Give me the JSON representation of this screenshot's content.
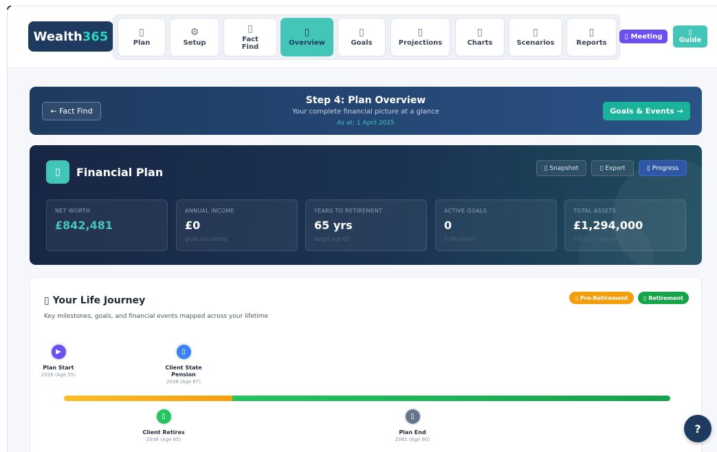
{
  "brand": {
    "name": "Wealth",
    "accent": "365"
  },
  "nav": [
    {
      "label": "Plan",
      "icon": "map-icon",
      "glyph": "▯"
    },
    {
      "label": "Setup",
      "icon": "gear-icon",
      "glyph": "⚙"
    },
    {
      "label": "Fact Find",
      "icon": "clipboard-icon",
      "glyph": "▯"
    },
    {
      "label": "Overview",
      "icon": "chart-icon",
      "glyph": "▯"
    },
    {
      "label": "Goals",
      "icon": "target-icon",
      "glyph": "▯"
    },
    {
      "label": "Projections",
      "icon": "trend-icon",
      "glyph": "▯"
    },
    {
      "label": "Charts",
      "icon": "bar-chart-icon",
      "glyph": "▯"
    },
    {
      "label": "Scenarios",
      "icon": "branch-icon",
      "glyph": "▯"
    },
    {
      "label": "Reports",
      "icon": "document-icon",
      "glyph": "▯"
    }
  ],
  "meeting_label": "▯ Meeting",
  "guide": {
    "glyph": "▯",
    "label": "Guide"
  },
  "step": {
    "back_label": "← Fact Find",
    "title": "Step 4: Plan Overview",
    "subtitle": "Your complete financial picture at a glance",
    "as_at": "As at: 1 April 2025",
    "next_label": "Goals & Events →"
  },
  "plan": {
    "icon_glyph": "▯",
    "title": "Financial Plan",
    "actions": {
      "snapshot": "▯ Snapshot",
      "export": "▯ Export",
      "progress": "▯ Progress"
    },
    "stats": [
      {
        "label": "NET WORTH",
        "value": "£842,481",
        "sub": ""
      },
      {
        "label": "ANNUAL INCOME",
        "value": "£0",
        "sub": "gross household"
      },
      {
        "label": "YEARS TO RETIREMENT",
        "value": "65 yrs",
        "sub": "target age 65"
      },
      {
        "label": "ACTIVE GOALS",
        "value": "0",
        "sub": "0 life events"
      },
      {
        "label": "TOTAL ASSETS",
        "value": "£1,294,000",
        "sub": "£451,519 liabilities"
      }
    ]
  },
  "journey": {
    "title": "▯ Your Life Journey",
    "subtitle": "Key milestones, goals, and financial events mapped across your lifetime",
    "badges": {
      "pre": "▯ Pre-Retirement",
      "ret": "▯ Retirement"
    },
    "milestones": [
      {
        "name": "Plan Start",
        "when": "2026 (Age 55)",
        "glyph": "▶"
      },
      {
        "name": "Client State Pension",
        "when": "2038 (Age 67)",
        "glyph": "▯"
      },
      {
        "name": "Client Retires",
        "when": "2036 (Age 65)",
        "glyph": "▯"
      },
      {
        "name": "Plan End",
        "when": "2061 (Age 90)",
        "glyph": "▯"
      }
    ]
  },
  "colors": {
    "navy": "#1e3a5f",
    "teal": "#43c6b8",
    "pre_retirement": "#f59e0b",
    "retirement": "#16a34a",
    "meeting": "#6d4ef0"
  },
  "help_label": "?"
}
